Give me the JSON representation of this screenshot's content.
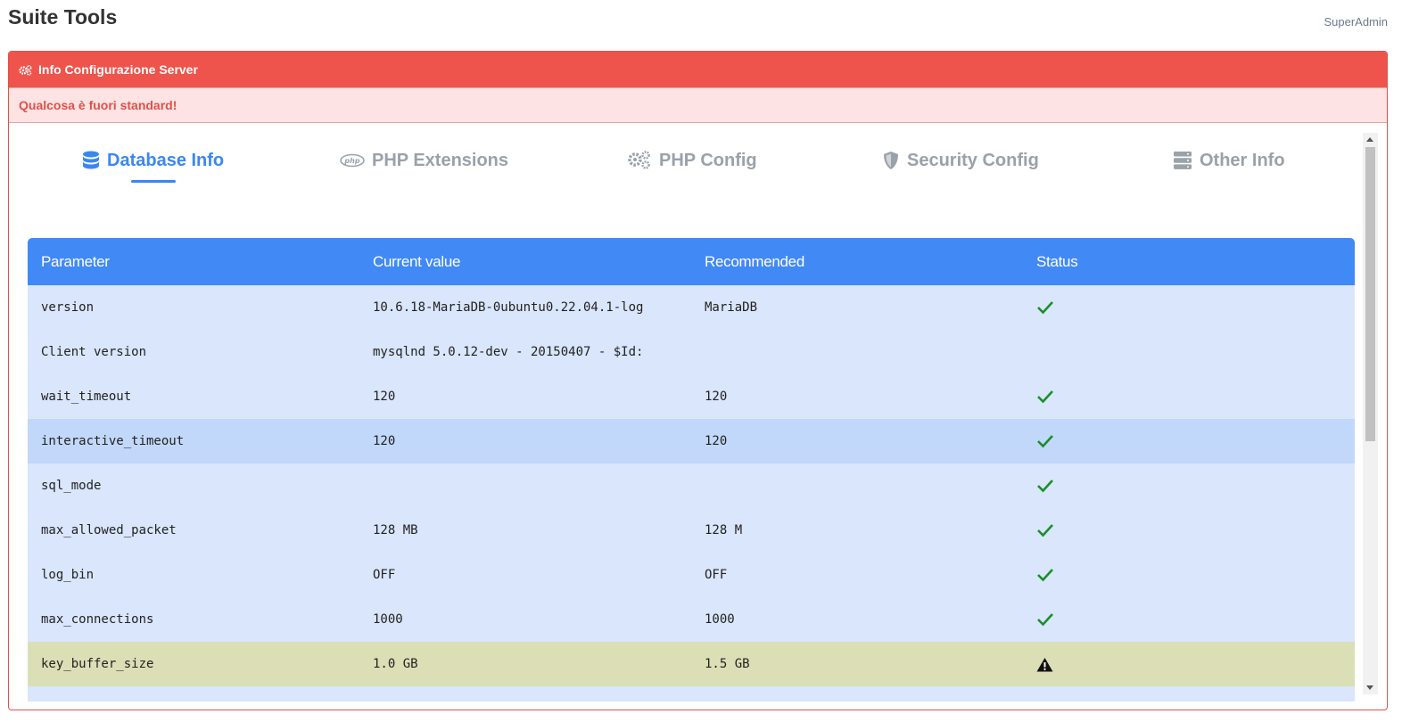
{
  "header": {
    "title": "Suite Tools",
    "user": "SuperAdmin"
  },
  "panel": {
    "title": "Info Configurazione Server",
    "alert": "Qualcosa è fuori standard!",
    "accent_color": "#ee534c"
  },
  "tabs": [
    {
      "label": "Database Info",
      "icon": "database-icon",
      "active": true
    },
    {
      "label": "PHP Extensions",
      "icon": "php-icon",
      "active": false
    },
    {
      "label": "PHP Config",
      "icon": "gears-icon",
      "active": false
    },
    {
      "label": "Security Config",
      "icon": "shield-icon",
      "active": false
    },
    {
      "label": "Other Info",
      "icon": "server-icon",
      "active": false
    }
  ],
  "table": {
    "columns": [
      "Parameter",
      "Current value",
      "Recommended",
      "Status"
    ],
    "rows": [
      {
        "parameter": "version",
        "current": "10.6.18-MariaDB-0ubuntu0.22.04.1-log",
        "recommended": "MariaDB",
        "status": "ok"
      },
      {
        "parameter": "Client version",
        "current": "mysqlnd 5.0.12-dev - 20150407 - $Id:",
        "recommended": "",
        "status": "none"
      },
      {
        "parameter": "wait_timeout",
        "current": "120",
        "recommended": "120",
        "status": "ok"
      },
      {
        "parameter": "interactive_timeout",
        "current": "120",
        "recommended": "120",
        "status": "ok"
      },
      {
        "parameter": "sql_mode",
        "current": "",
        "recommended": "",
        "status": "ok"
      },
      {
        "parameter": "max_allowed_packet",
        "current": "128 MB",
        "recommended": "128 M",
        "status": "ok"
      },
      {
        "parameter": "log_bin",
        "current": "OFF",
        "recommended": "OFF",
        "status": "ok"
      },
      {
        "parameter": "max_connections",
        "current": "1000",
        "recommended": "1000",
        "status": "ok"
      },
      {
        "parameter": "key_buffer_size",
        "current": "1.0 GB",
        "recommended": "1.5 GB",
        "status": "warning"
      }
    ]
  },
  "colors": {
    "active_tab": "#3b87f0",
    "table_header": "#4189f5",
    "row_bg": "#d9e6fb",
    "row_highlight": "#c2d8fa",
    "row_warning": "#dbdfb5",
    "ok_check": "#1a8f2a"
  }
}
